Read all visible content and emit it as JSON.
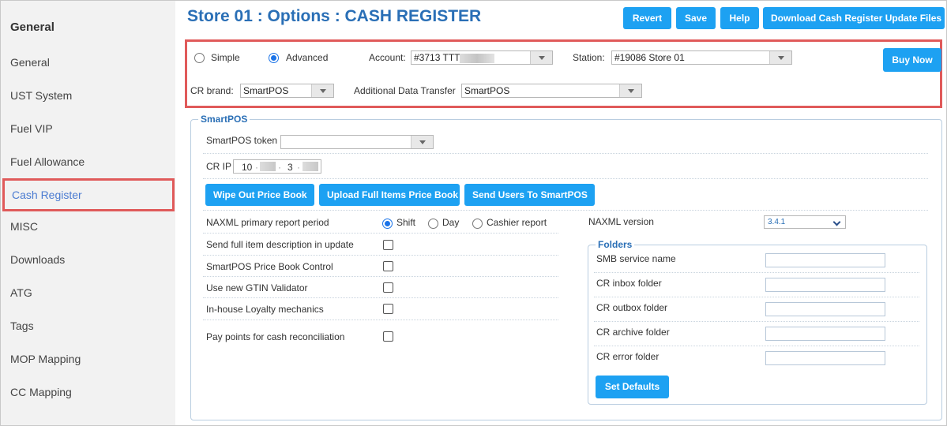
{
  "sidebar": {
    "heading": "General",
    "items": [
      {
        "label": "General"
      },
      {
        "label": "UST System"
      },
      {
        "label": "Fuel VIP"
      },
      {
        "label": "Fuel Allowance"
      },
      {
        "label": "Cash Register",
        "active": true
      },
      {
        "label": "MISC"
      },
      {
        "label": "Downloads"
      },
      {
        "label": "ATG"
      },
      {
        "label": "Tags"
      },
      {
        "label": "MOP Mapping"
      },
      {
        "label": "CC Mapping"
      }
    ]
  },
  "header": {
    "title": "Store 01 : Options : CASH REGISTER",
    "buttons": {
      "revert": "Revert",
      "save": "Save",
      "help": "Help",
      "download": "Download Cash Register Update Files"
    }
  },
  "options": {
    "mode_simple": "Simple",
    "mode_advanced": "Advanced",
    "selected_mode": "Advanced",
    "account_label": "Account:",
    "account_value": "#3713 TTT",
    "station_label": "Station:",
    "station_value": "#19086 Store 01",
    "buy_now": "Buy Now",
    "cr_brand_label": "CR brand:",
    "cr_brand_value": "SmartPOS",
    "additional_transfer_label": "Additional Data Transfer",
    "additional_transfer_value": "SmartPOS"
  },
  "smartpos": {
    "legend": "SmartPOS",
    "token_label": "SmartPOS token",
    "token_value": "",
    "cr_ip_label": "CR IP",
    "cr_ip_part1": "10",
    "cr_ip_part3": "3",
    "btn_wipe": "Wipe Out Price Book",
    "btn_upload": "Upload Full Items Price Book",
    "btn_send_users": "Send Users To SmartPOS",
    "naxml_period_label": "NAXML primary report period",
    "period_shift": "Shift",
    "period_day": "Day",
    "period_cashier": "Cashier report",
    "selected_period": "Shift",
    "naxml_version_label": "NAXML version",
    "naxml_version_value": "3.4.1",
    "send_full_desc": "Send full item description in update",
    "price_book_control": "SmartPOS Price Book Control",
    "gtin_validator": "Use new GTIN Validator",
    "loyalty": "In-house Loyalty mechanics",
    "pay_points": "Pay points for cash reconciliation"
  },
  "folders": {
    "legend": "Folders",
    "smb": "SMB service name",
    "inbox": "CR inbox folder",
    "outbox": "CR outbox folder",
    "archive": "CR archive folder",
    "error": "CR error folder",
    "set_defaults": "Set Defaults"
  },
  "colors": {
    "accent": "#1da1f2",
    "title": "#2a6fb6",
    "highlight_border": "#e05a5a",
    "sidebar_bg": "#f2f2f2",
    "active_item": "#4a7bd1"
  }
}
